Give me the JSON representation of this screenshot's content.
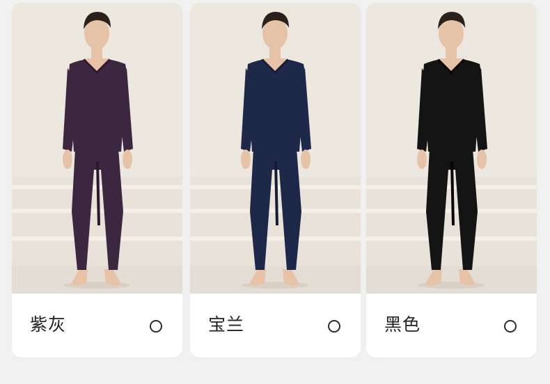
{
  "options": [
    {
      "name": "紫灰",
      "garment_color": "#3d2640",
      "garment_shade": "#2b1a2e"
    },
    {
      "name": "宝兰",
      "garment_color": "#1e2849",
      "garment_shade": "#141b33"
    },
    {
      "name": "黑色",
      "garment_color": "#141414",
      "garment_shade": "#050505"
    }
  ],
  "colors": {
    "page_background": "#f1f1f1",
    "photo_background": "#ece7df",
    "skin": "#e6c3a6",
    "hair": "#2a211c",
    "radio_border": "#2b2b2b"
  },
  "icons": {
    "radio": "radio-unselected-icon"
  }
}
